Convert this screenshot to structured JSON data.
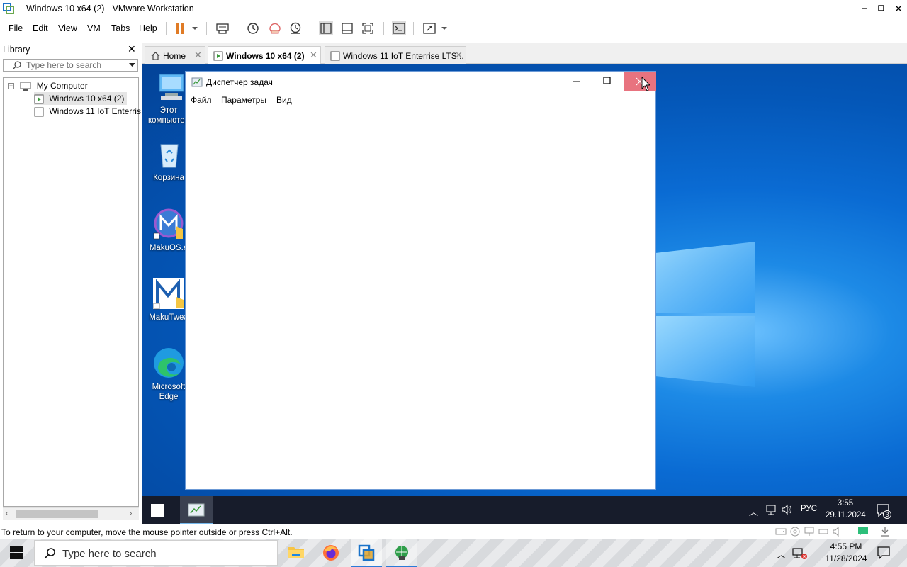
{
  "window": {
    "title": "Windows 10 x64 (2) - VMware Workstation"
  },
  "menu": {
    "items": [
      "File",
      "Edit",
      "View",
      "VM",
      "Tabs",
      "Help"
    ]
  },
  "library": {
    "header": "Library",
    "search_placeholder": "Type here to search",
    "tree": {
      "root": "My Computer",
      "vms": [
        "Windows 10 x64 (2)",
        "Windows 11 IoT Enterris"
      ]
    }
  },
  "tabs": [
    {
      "label": "Home",
      "active": false
    },
    {
      "label": "Windows 10 x64 (2)",
      "active": true
    },
    {
      "label": "Windows 11 IoT Enterrise LTS...",
      "active": false
    }
  ],
  "guest": {
    "desktop_icons": [
      {
        "label": "Этот компьютер",
        "icon": "computer-icon"
      },
      {
        "label": "Корзина",
        "icon": "recycle-bin-icon"
      },
      {
        "label": "MakuOS.e",
        "icon": "makuos-icon"
      },
      {
        "label": "MakuTwea",
        "icon": "makutweaker-icon"
      },
      {
        "label": "Microsoft Edge",
        "icon": "edge-icon"
      }
    ],
    "task_manager": {
      "title": "Диспетчер задач",
      "menu": [
        "Файл",
        "Параметры",
        "Вид"
      ]
    },
    "taskbar": {
      "language": "РУС",
      "time": "3:55",
      "date": "29.11.2024",
      "notifications": "3"
    }
  },
  "status": {
    "message": "To return to your computer, move the mouse pointer outside or press Ctrl+Alt."
  },
  "host_taskbar": {
    "search_placeholder": "Type here to search",
    "time": "4:55 PM",
    "date": "11/28/2024"
  },
  "colors": {
    "close_hover": "#e8737f",
    "desktop_blue": "#0a6bd3",
    "taskbar_dark": "#171c2b"
  }
}
